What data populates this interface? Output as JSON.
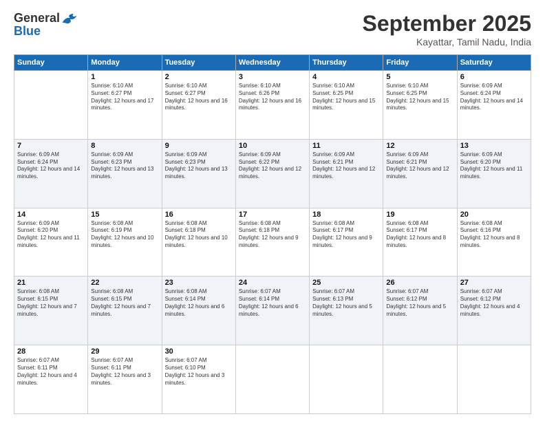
{
  "logo": {
    "general": "General",
    "blue": "Blue"
  },
  "title": "September 2025",
  "subtitle": "Kayattar, Tamil Nadu, India",
  "days": [
    "Sunday",
    "Monday",
    "Tuesday",
    "Wednesday",
    "Thursday",
    "Friday",
    "Saturday"
  ],
  "weeks": [
    [
      {
        "day": "",
        "sunrise": "",
        "sunset": "",
        "daylight": ""
      },
      {
        "day": "1",
        "sunrise": "Sunrise: 6:10 AM",
        "sunset": "Sunset: 6:27 PM",
        "daylight": "Daylight: 12 hours and 17 minutes."
      },
      {
        "day": "2",
        "sunrise": "Sunrise: 6:10 AM",
        "sunset": "Sunset: 6:27 PM",
        "daylight": "Daylight: 12 hours and 16 minutes."
      },
      {
        "day": "3",
        "sunrise": "Sunrise: 6:10 AM",
        "sunset": "Sunset: 6:26 PM",
        "daylight": "Daylight: 12 hours and 16 minutes."
      },
      {
        "day": "4",
        "sunrise": "Sunrise: 6:10 AM",
        "sunset": "Sunset: 6:25 PM",
        "daylight": "Daylight: 12 hours and 15 minutes."
      },
      {
        "day": "5",
        "sunrise": "Sunrise: 6:10 AM",
        "sunset": "Sunset: 6:25 PM",
        "daylight": "Daylight: 12 hours and 15 minutes."
      },
      {
        "day": "6",
        "sunrise": "Sunrise: 6:09 AM",
        "sunset": "Sunset: 6:24 PM",
        "daylight": "Daylight: 12 hours and 14 minutes."
      }
    ],
    [
      {
        "day": "7",
        "sunrise": "Sunrise: 6:09 AM",
        "sunset": "Sunset: 6:24 PM",
        "daylight": "Daylight: 12 hours and 14 minutes."
      },
      {
        "day": "8",
        "sunrise": "Sunrise: 6:09 AM",
        "sunset": "Sunset: 6:23 PM",
        "daylight": "Daylight: 12 hours and 13 minutes."
      },
      {
        "day": "9",
        "sunrise": "Sunrise: 6:09 AM",
        "sunset": "Sunset: 6:23 PM",
        "daylight": "Daylight: 12 hours and 13 minutes."
      },
      {
        "day": "10",
        "sunrise": "Sunrise: 6:09 AM",
        "sunset": "Sunset: 6:22 PM",
        "daylight": "Daylight: 12 hours and 12 minutes."
      },
      {
        "day": "11",
        "sunrise": "Sunrise: 6:09 AM",
        "sunset": "Sunset: 6:21 PM",
        "daylight": "Daylight: 12 hours and 12 minutes."
      },
      {
        "day": "12",
        "sunrise": "Sunrise: 6:09 AM",
        "sunset": "Sunset: 6:21 PM",
        "daylight": "Daylight: 12 hours and 12 minutes."
      },
      {
        "day": "13",
        "sunrise": "Sunrise: 6:09 AM",
        "sunset": "Sunset: 6:20 PM",
        "daylight": "Daylight: 12 hours and 11 minutes."
      }
    ],
    [
      {
        "day": "14",
        "sunrise": "Sunrise: 6:09 AM",
        "sunset": "Sunset: 6:20 PM",
        "daylight": "Daylight: 12 hours and 11 minutes."
      },
      {
        "day": "15",
        "sunrise": "Sunrise: 6:08 AM",
        "sunset": "Sunset: 6:19 PM",
        "daylight": "Daylight: 12 hours and 10 minutes."
      },
      {
        "day": "16",
        "sunrise": "Sunrise: 6:08 AM",
        "sunset": "Sunset: 6:18 PM",
        "daylight": "Daylight: 12 hours and 10 minutes."
      },
      {
        "day": "17",
        "sunrise": "Sunrise: 6:08 AM",
        "sunset": "Sunset: 6:18 PM",
        "daylight": "Daylight: 12 hours and 9 minutes."
      },
      {
        "day": "18",
        "sunrise": "Sunrise: 6:08 AM",
        "sunset": "Sunset: 6:17 PM",
        "daylight": "Daylight: 12 hours and 9 minutes."
      },
      {
        "day": "19",
        "sunrise": "Sunrise: 6:08 AM",
        "sunset": "Sunset: 6:17 PM",
        "daylight": "Daylight: 12 hours and 8 minutes."
      },
      {
        "day": "20",
        "sunrise": "Sunrise: 6:08 AM",
        "sunset": "Sunset: 6:16 PM",
        "daylight": "Daylight: 12 hours and 8 minutes."
      }
    ],
    [
      {
        "day": "21",
        "sunrise": "Sunrise: 6:08 AM",
        "sunset": "Sunset: 6:15 PM",
        "daylight": "Daylight: 12 hours and 7 minutes."
      },
      {
        "day": "22",
        "sunrise": "Sunrise: 6:08 AM",
        "sunset": "Sunset: 6:15 PM",
        "daylight": "Daylight: 12 hours and 7 minutes."
      },
      {
        "day": "23",
        "sunrise": "Sunrise: 6:08 AM",
        "sunset": "Sunset: 6:14 PM",
        "daylight": "Daylight: 12 hours and 6 minutes."
      },
      {
        "day": "24",
        "sunrise": "Sunrise: 6:07 AM",
        "sunset": "Sunset: 6:14 PM",
        "daylight": "Daylight: 12 hours and 6 minutes."
      },
      {
        "day": "25",
        "sunrise": "Sunrise: 6:07 AM",
        "sunset": "Sunset: 6:13 PM",
        "daylight": "Daylight: 12 hours and 5 minutes."
      },
      {
        "day": "26",
        "sunrise": "Sunrise: 6:07 AM",
        "sunset": "Sunset: 6:12 PM",
        "daylight": "Daylight: 12 hours and 5 minutes."
      },
      {
        "day": "27",
        "sunrise": "Sunrise: 6:07 AM",
        "sunset": "Sunset: 6:12 PM",
        "daylight": "Daylight: 12 hours and 4 minutes."
      }
    ],
    [
      {
        "day": "28",
        "sunrise": "Sunrise: 6:07 AM",
        "sunset": "Sunset: 6:11 PM",
        "daylight": "Daylight: 12 hours and 4 minutes."
      },
      {
        "day": "29",
        "sunrise": "Sunrise: 6:07 AM",
        "sunset": "Sunset: 6:11 PM",
        "daylight": "Daylight: 12 hours and 3 minutes."
      },
      {
        "day": "30",
        "sunrise": "Sunrise: 6:07 AM",
        "sunset": "Sunset: 6:10 PM",
        "daylight": "Daylight: 12 hours and 3 minutes."
      },
      {
        "day": "",
        "sunrise": "",
        "sunset": "",
        "daylight": ""
      },
      {
        "day": "",
        "sunrise": "",
        "sunset": "",
        "daylight": ""
      },
      {
        "day": "",
        "sunrise": "",
        "sunset": "",
        "daylight": ""
      },
      {
        "day": "",
        "sunrise": "",
        "sunset": "",
        "daylight": ""
      }
    ]
  ]
}
